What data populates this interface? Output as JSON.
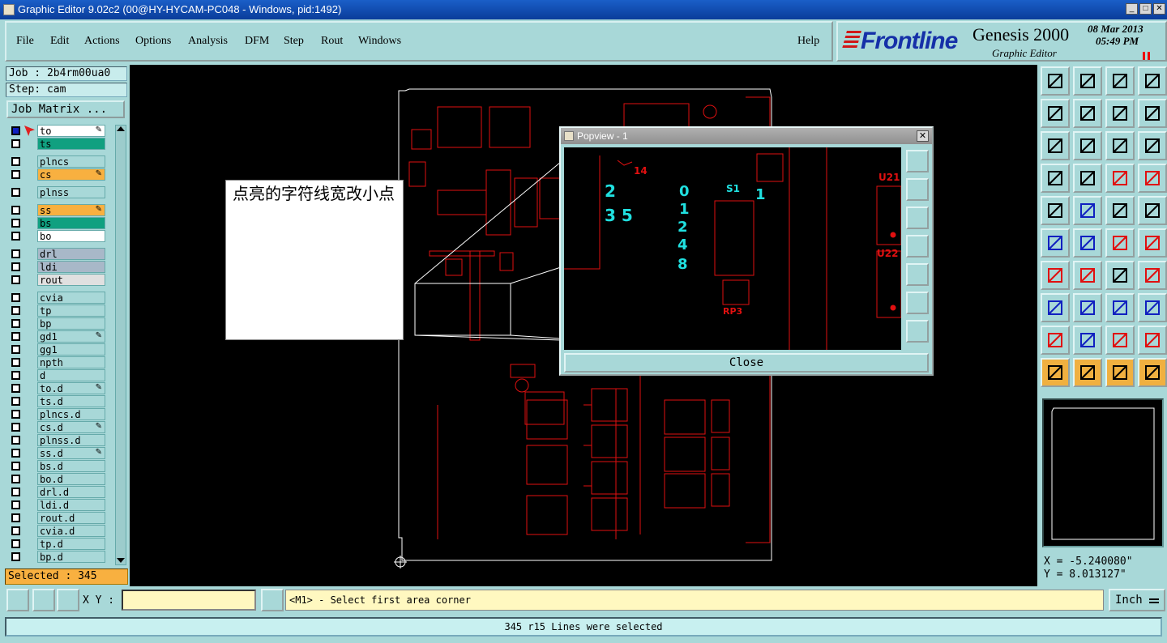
{
  "window": {
    "title": "Graphic Editor 9.02c2 (00@HY-HYCAM-PC048 - Windows, pid:1492)"
  },
  "menu": {
    "items": [
      "File",
      "Edit",
      "Actions",
      "Options",
      "Analysis",
      "DFM",
      "Step",
      "Rout",
      "Windows"
    ],
    "help": "Help"
  },
  "brand": {
    "logo": "Frontline",
    "product": "Genesis 2000",
    "subtitle": "Graphic Editor",
    "date": "08 Mar 2013",
    "time": "05:49 PM"
  },
  "job": {
    "job_label": "Job : 2b4rm00ua0",
    "step_label": "Step: cam",
    "matrix_button": "Job Matrix ..."
  },
  "layers": [
    {
      "name": "to",
      "color": "#ffffff",
      "checked": true,
      "edit": true,
      "pointer": true
    },
    {
      "name": "ts",
      "color": "#10a080",
      "checked": false,
      "edit": false
    },
    {
      "name": "plncs",
      "color": "#a8d8d8",
      "checked": false,
      "edit": false
    },
    {
      "name": "cs",
      "color": "#f8b040",
      "checked": false,
      "edit": true
    },
    {
      "name": "plnss",
      "color": "#a8d8d8",
      "checked": false,
      "edit": false
    },
    {
      "name": "ss",
      "color": "#f8b040",
      "checked": false,
      "edit": true
    },
    {
      "name": "bs",
      "color": "#10a080",
      "checked": false,
      "edit": false
    },
    {
      "name": "bo",
      "color": "#ffffff",
      "checked": false,
      "edit": false
    },
    {
      "name": "drl",
      "color": "#a8b8c8",
      "checked": false,
      "edit": false
    },
    {
      "name": "ldi",
      "color": "#a8b8c8",
      "checked": false,
      "edit": false
    },
    {
      "name": "rout",
      "color": "#e0e0e0",
      "checked": false,
      "edit": false
    },
    {
      "name": "cvia",
      "color": "#a8d8d8",
      "checked": false,
      "edit": false
    },
    {
      "name": "tp",
      "color": "#a8d8d8",
      "checked": false,
      "edit": false
    },
    {
      "name": "bp",
      "color": "#a8d8d8",
      "checked": false,
      "edit": false
    },
    {
      "name": "gd1",
      "color": "#a8d8d8",
      "checked": false,
      "edit": true
    },
    {
      "name": "gg1",
      "color": "#a8d8d8",
      "checked": false,
      "edit": false
    },
    {
      "name": "npth",
      "color": "#a8d8d8",
      "checked": false,
      "edit": false
    },
    {
      "name": "d",
      "color": "#a8d8d8",
      "checked": false,
      "edit": false
    },
    {
      "name": "to.d",
      "color": "#a8d8d8",
      "checked": false,
      "edit": true
    },
    {
      "name": "ts.d",
      "color": "#a8d8d8",
      "checked": false,
      "edit": false
    },
    {
      "name": "plncs.d",
      "color": "#a8d8d8",
      "checked": false,
      "edit": false
    },
    {
      "name": "cs.d",
      "color": "#a8d8d8",
      "checked": false,
      "edit": true
    },
    {
      "name": "plnss.d",
      "color": "#a8d8d8",
      "checked": false,
      "edit": false
    },
    {
      "name": "ss.d",
      "color": "#a8d8d8",
      "checked": false,
      "edit": true
    },
    {
      "name": "bs.d",
      "color": "#a8d8d8",
      "checked": false,
      "edit": false
    },
    {
      "name": "bo.d",
      "color": "#a8d8d8",
      "checked": false,
      "edit": false
    },
    {
      "name": "drl.d",
      "color": "#a8d8d8",
      "checked": false,
      "edit": false
    },
    {
      "name": "ldi.d",
      "color": "#a8d8d8",
      "checked": false,
      "edit": false
    },
    {
      "name": "rout.d",
      "color": "#a8d8d8",
      "checked": false,
      "edit": false
    },
    {
      "name": "cvia.d",
      "color": "#a8d8d8",
      "checked": false,
      "edit": false
    },
    {
      "name": "tp.d",
      "color": "#a8d8d8",
      "checked": false,
      "edit": false
    },
    {
      "name": "bp.d",
      "color": "#a8d8d8",
      "checked": false,
      "edit": false
    }
  ],
  "selected_count": "Selected : 345",
  "note_text": "点亮的字符线宽改小点",
  "popview": {
    "title": "Popview - 1",
    "close_label": "Close",
    "labels": [
      {
        "t": "2"
      },
      {
        "t": "3 5"
      },
      {
        "t": "0"
      },
      {
        "t": "S1"
      },
      {
        "t": "1"
      },
      {
        "t": "1"
      },
      {
        "t": "2"
      },
      {
        "t": "4"
      },
      {
        "t": "8"
      },
      {
        "t": "U21"
      },
      {
        "t": "U22"
      },
      {
        "t": "RP3"
      },
      {
        "t": "14"
      }
    ]
  },
  "coords": {
    "x": "X = -5.240080\"",
    "y": "Y = 8.013127\""
  },
  "bottom": {
    "xy_label": "X Y :",
    "xy_value": "",
    "prompt": "<M1> - Select first area corner",
    "units": "Inch"
  },
  "status": "345 r15 Lines were selected",
  "colors": {
    "accent": "#a8d8d8",
    "copper": "#e01010",
    "highlight": "#20e0e0",
    "selected_bg": "#f8b040"
  },
  "icons": [
    "lines-icon",
    "ruler-icon"
  ]
}
